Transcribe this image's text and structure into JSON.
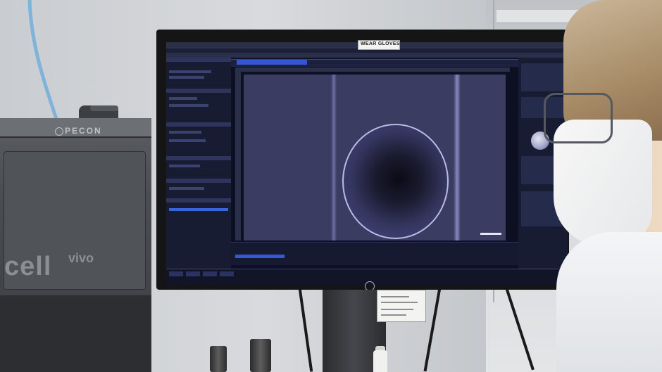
{
  "scene": {
    "monitor_tape_label": "WEAR GLOVES",
    "device_brand": "PECON",
    "device_model_word1": "cell",
    "device_model_word2": "vivo"
  },
  "colors": {
    "screen_background": "#0c1022",
    "software_accent": "#3558d8",
    "microscope_field": "#3b3c62",
    "wall": "#cfd2d6"
  },
  "icons": {
    "monitor_brand": "hp-logo-icon",
    "objective_lens": "objective-lens-icon"
  }
}
